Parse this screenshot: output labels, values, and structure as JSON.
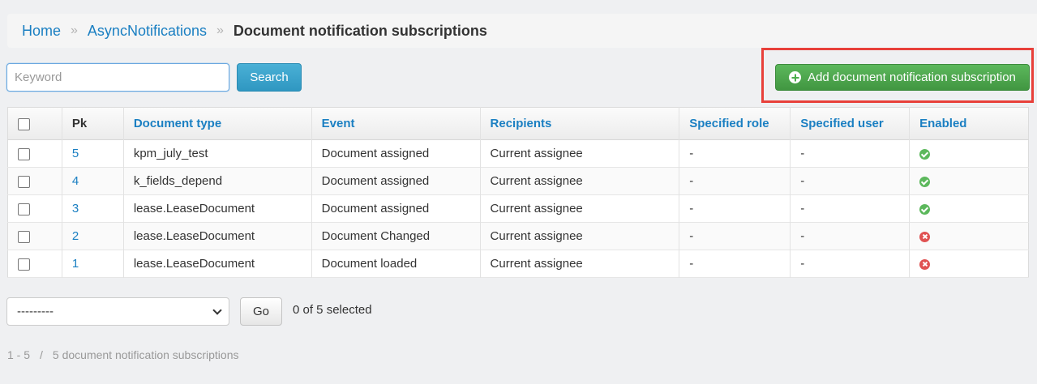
{
  "breadcrumb": {
    "home": "Home",
    "separator": "»",
    "section": "AsyncNotifications",
    "current": "Document notification subscriptions"
  },
  "search": {
    "placeholder": "Keyword",
    "value": "",
    "button_label": "Search"
  },
  "actions": {
    "add_label": "Add document notification subscription",
    "add_icon": "plus-circle-icon",
    "highlight_color": "#e8403a"
  },
  "table": {
    "headers": {
      "pk": "Pk",
      "document_type": "Document type",
      "event": "Event",
      "recipients": "Recipients",
      "specified_role": "Specified role",
      "specified_user": "Specified user",
      "enabled": "Enabled"
    },
    "rows": [
      {
        "pk": "5",
        "document_type": "kpm_july_test",
        "event": "Document assigned",
        "recipients": "Current assignee",
        "specified_role": "-",
        "specified_user": "-",
        "enabled": "yes-icon"
      },
      {
        "pk": "4",
        "document_type": "k_fields_depend",
        "event": "Document assigned",
        "recipients": "Current assignee",
        "specified_role": "-",
        "specified_user": "-",
        "enabled": "yes-icon"
      },
      {
        "pk": "3",
        "document_type": "lease.LeaseDocument",
        "event": "Document assigned",
        "recipients": "Current assignee",
        "specified_role": "-",
        "specified_user": "-",
        "enabled": "yes-icon"
      },
      {
        "pk": "2",
        "document_type": "lease.LeaseDocument",
        "event": "Document Changed",
        "recipients": "Current assignee",
        "specified_role": "-",
        "specified_user": "-",
        "enabled": "no-icon"
      },
      {
        "pk": "1",
        "document_type": "lease.LeaseDocument",
        "event": "Document loaded",
        "recipients": "Current assignee",
        "specified_role": "-",
        "specified_user": "-",
        "enabled": "no-icon"
      }
    ]
  },
  "bulk_actions": {
    "selected_option": "---------",
    "go_label": "Go",
    "selected_count": "0 of 5 selected"
  },
  "pagination": {
    "range": "1 - 5",
    "separator": "/",
    "total": "5 document notification subscriptions"
  },
  "colors": {
    "link": "#1a7fc2",
    "search_button": "#2f97c1",
    "add_button": "#4cae4c",
    "enabled_yes": "#5cb85c",
    "enabled_no": "#e05252"
  }
}
